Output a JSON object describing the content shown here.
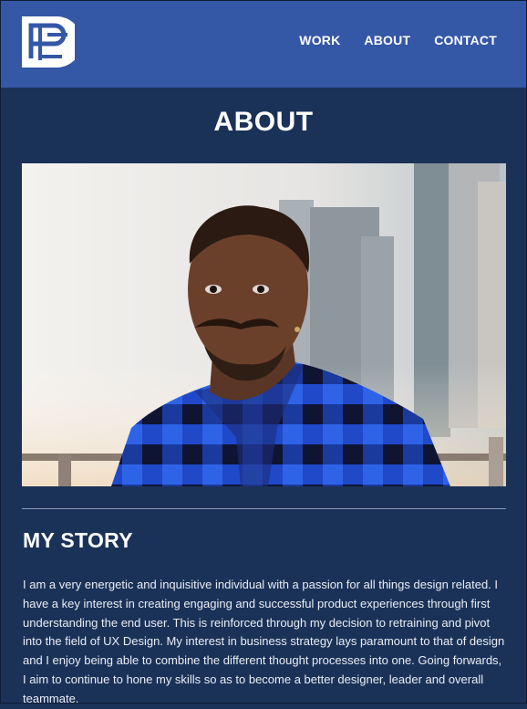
{
  "header": {
    "nav": {
      "work": "WORK",
      "about": "ABOUT",
      "contact": "CONTACT"
    }
  },
  "colors": {
    "header_bg": "#3457a6",
    "page_bg": "#1b3258",
    "text": "#ffffff"
  },
  "page": {
    "title": "ABOUT"
  },
  "story": {
    "heading": "MY STORY",
    "body": "I am a very energetic and inquisitive individual with a passion for all things design related. I have a key interest in creating engaging and successful product experiences through first understanding the end user. This is reinforced through my decision to retraining and pivot into the field of UX Design. My interest in business strategy lays paramount to that of design and I enjoy being able to combine the different thought processes into one. Going forwards, I aim to continue to hone my skills so as to become a better designer, leader and overall teammate."
  },
  "icons": [
    "logo-icon"
  ]
}
